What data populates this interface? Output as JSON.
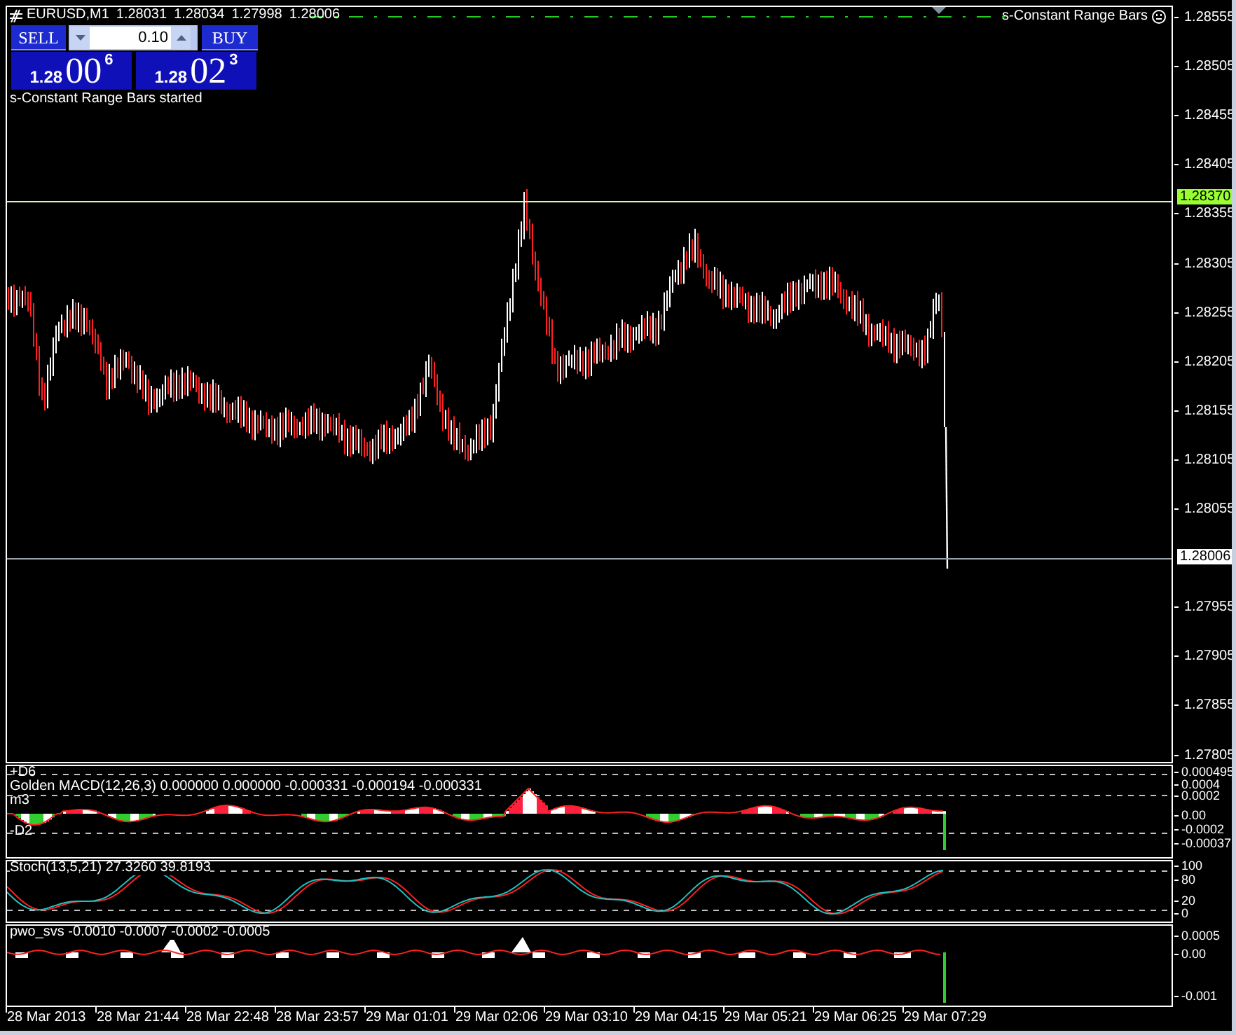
{
  "window": {
    "title": "EURUSD,M1",
    "ohlc": [
      "1.28031",
      "1.28034",
      "1.27998",
      "1.28006"
    ]
  },
  "trade_panel": {
    "sell_label": "SELL",
    "buy_label": "BUY",
    "lot": "0.10",
    "bid": {
      "big": "1.28",
      "pips": "00",
      "point": "6"
    },
    "ask": {
      "big": "1.28",
      "pips": "02",
      "point": "3"
    }
  },
  "message": "s-Constant Range Bars started",
  "indicator_label": "s-Constant Range Bars",
  "price_axis": [
    "1.28555",
    "1.28505",
    "1.28455",
    "1.28405",
    "1.28355",
    "1.28305",
    "1.28255",
    "1.28205",
    "1.28155",
    "1.28105",
    "1.28055",
    "1.27955",
    "1.27905",
    "1.27855",
    "1.27805"
  ],
  "price_markers": [
    {
      "label": "1.28370",
      "kind": "alert"
    },
    {
      "label": "1.28006",
      "kind": "bid"
    }
  ],
  "subwindows": [
    {
      "kind": "macd",
      "title": "Golden MACD(12,26,3) 0.000000 0.000000 -0.000331 -0.000194 -0.000331",
      "labels": [
        "+D6",
        "m3",
        "-D2"
      ],
      "scale": [
        "0.000495",
        "0.0004",
        "0.0002",
        "0.00",
        "-0.0002",
        "-0.00037"
      ]
    },
    {
      "kind": "stoch",
      "title": "Stoch(13,5,21) 27.3260 39.8193",
      "scale": [
        "100",
        "80",
        "20",
        "0"
      ]
    },
    {
      "kind": "pwo",
      "title": "pwo_svs -0.0010 -0.0007 -0.0002 -0.0005",
      "scale": [
        "0.0005",
        "0.00",
        "-0.001"
      ]
    }
  ],
  "time_axis": [
    "28 Mar 2013",
    "28 Mar 21:44",
    "28 Mar 22:48",
    "28 Mar 23:57",
    "29 Mar 01:01",
    "29 Mar 02:06",
    "29 Mar 03:10",
    "29 Mar 04:15",
    "29 Mar 05:21",
    "29 Mar 06:25",
    "29 Mar 07:29"
  ]
}
